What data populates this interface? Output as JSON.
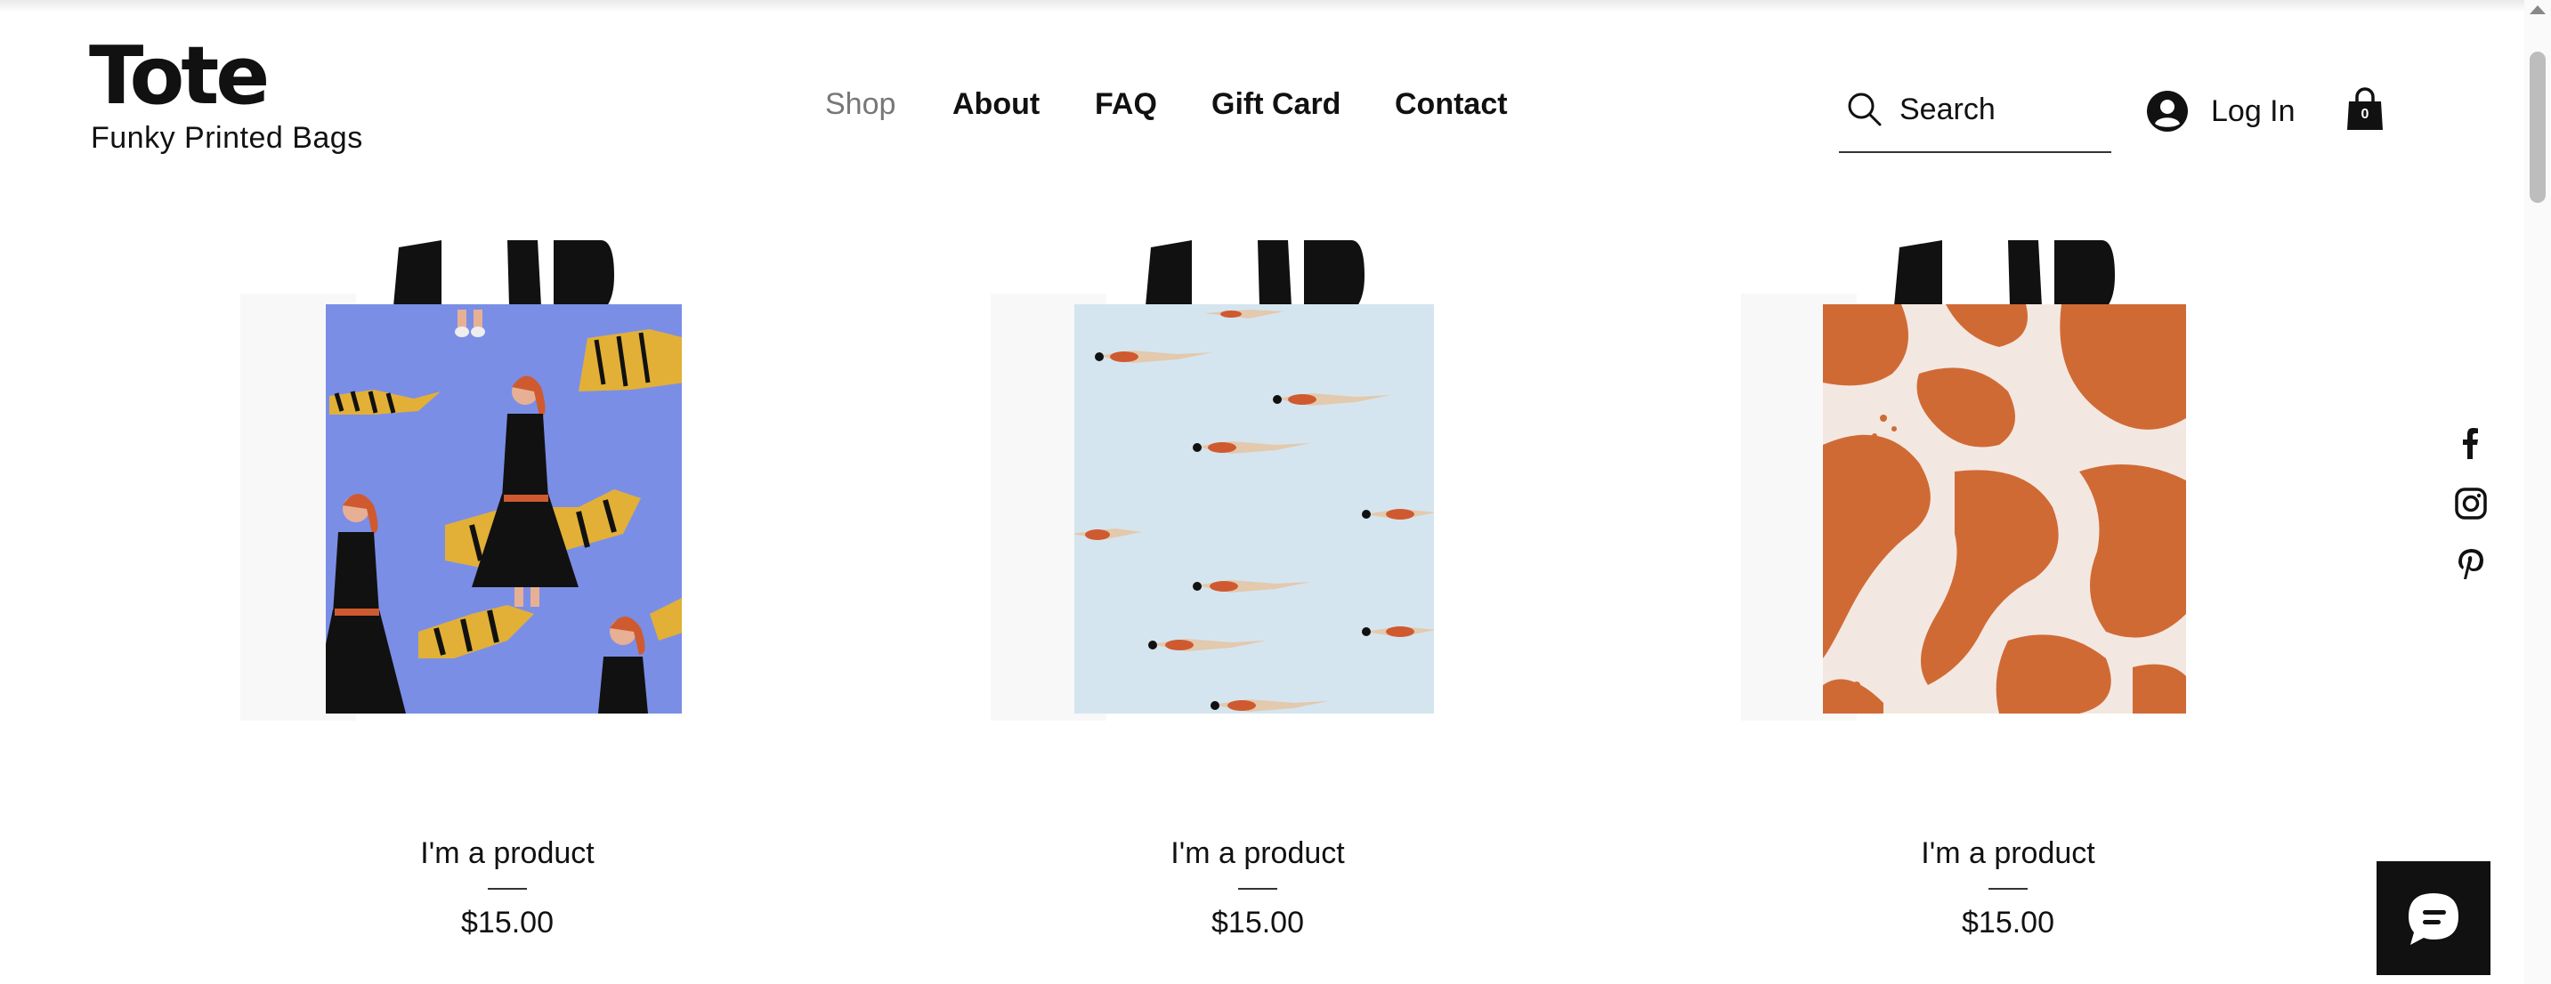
{
  "brand": {
    "title": "Tote",
    "subtitle": "Funky Printed Bags"
  },
  "nav": {
    "items": [
      {
        "label": "Shop",
        "active": true
      },
      {
        "label": "About",
        "active": false
      },
      {
        "label": "FAQ",
        "active": false
      },
      {
        "label": "Gift Card",
        "active": false
      },
      {
        "label": "Contact",
        "active": false
      }
    ]
  },
  "search": {
    "placeholder": "Search",
    "icon": "search-icon"
  },
  "account": {
    "login_label": "Log In",
    "icon": "user-avatar-icon"
  },
  "cart": {
    "count": "0",
    "icon": "shopping-bag-icon"
  },
  "products": [
    {
      "name": "I'm a product",
      "price": "$15.00",
      "pattern": "women-and-tigers",
      "bag_color": "#7b8ee6"
    },
    {
      "name": "I'm a product",
      "price": "$15.00",
      "pattern": "swimmers",
      "bag_color": "#d5e5ef"
    },
    {
      "name": "I'm a product",
      "price": "$15.00",
      "pattern": "orange-brushstrokes",
      "bag_color": "#d06a35"
    }
  ],
  "social": [
    {
      "name": "facebook-icon"
    },
    {
      "name": "instagram-icon"
    },
    {
      "name": "pinterest-icon"
    }
  ],
  "chat": {
    "icon": "chat-bubble-icon"
  }
}
